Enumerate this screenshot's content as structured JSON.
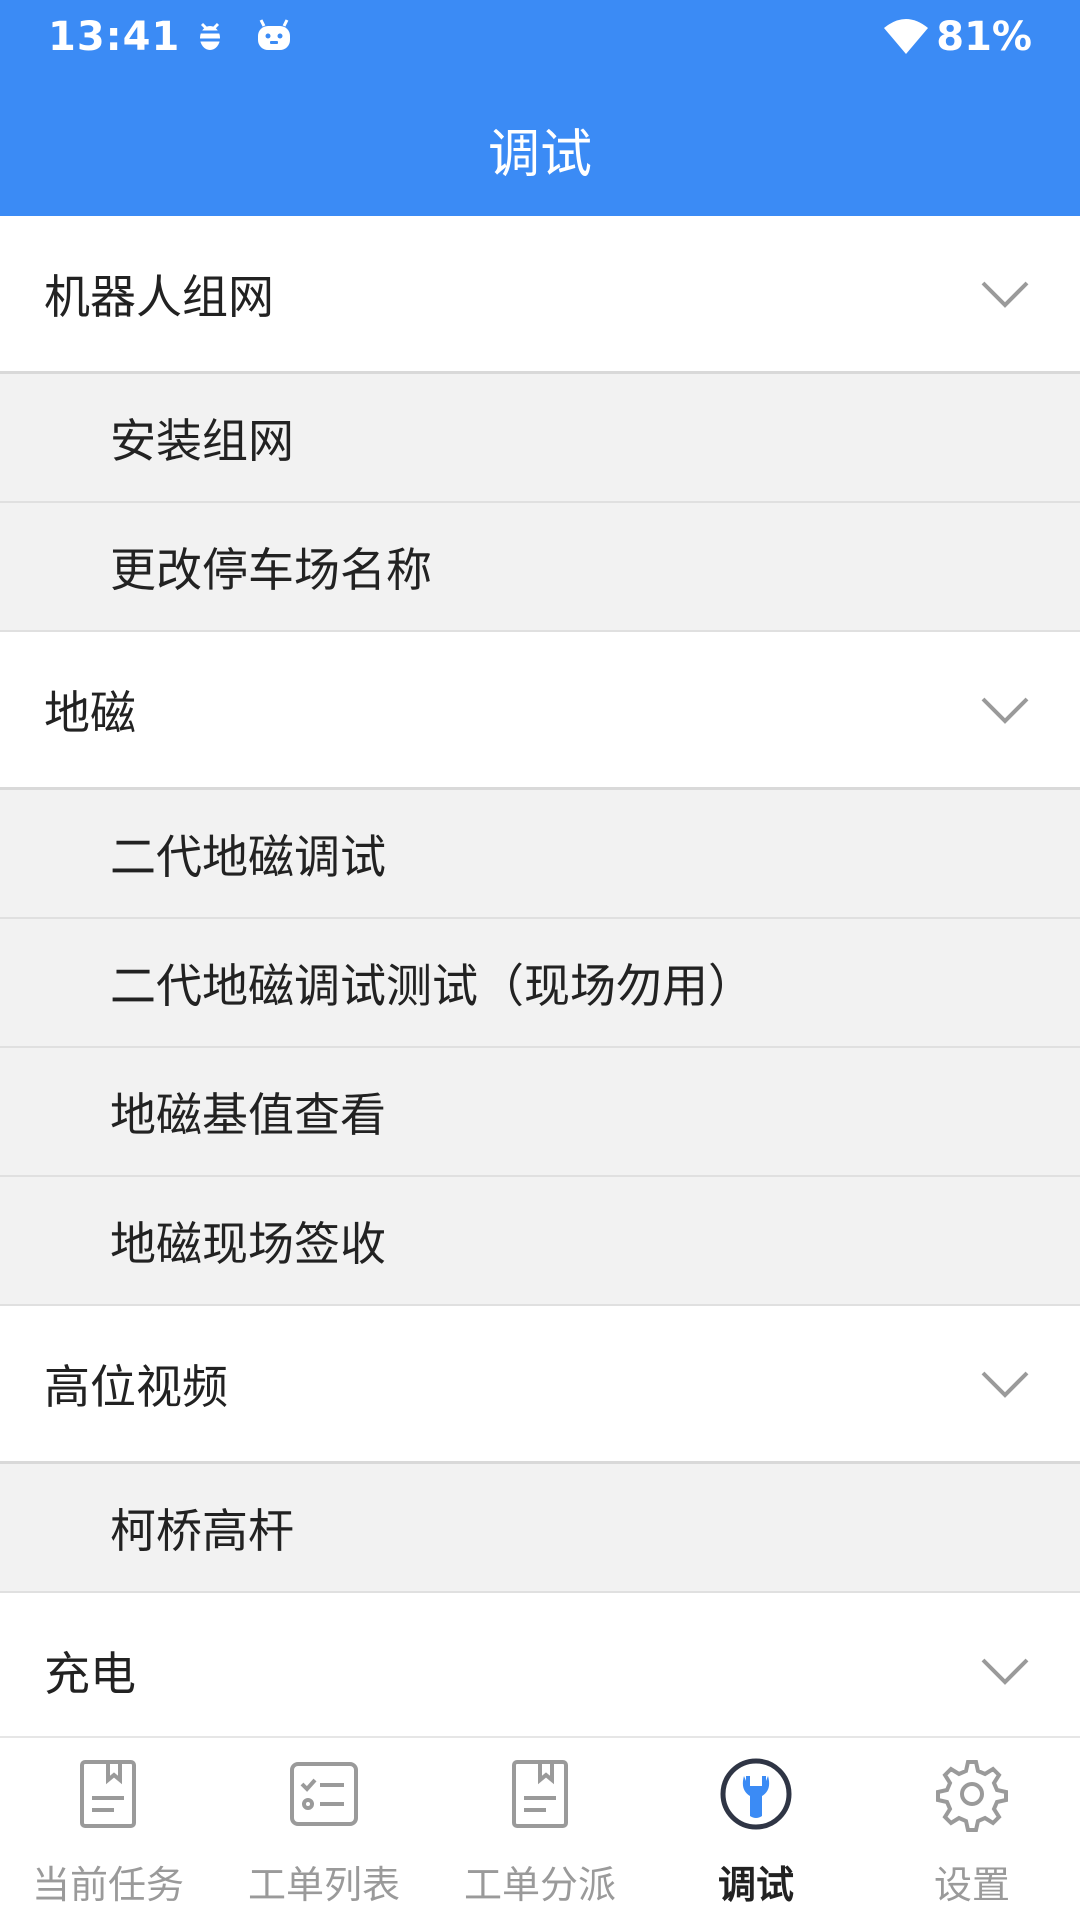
{
  "status_bar": {
    "time": "13:41",
    "battery": "81%"
  },
  "header": {
    "title": "调试"
  },
  "sections": [
    {
      "label": "机器人组网",
      "items": [
        "安装组网",
        "更改停车场名称"
      ]
    },
    {
      "label": "地磁",
      "items": [
        "二代地磁调试",
        "二代地磁调试测试（现场勿用）",
        "地磁基值查看",
        "地磁现场签收"
      ]
    },
    {
      "label": "高位视频",
      "items": [
        "柯桥高杆"
      ]
    },
    {
      "label": "充电",
      "items": []
    }
  ],
  "tabbar": {
    "tabs": [
      {
        "label": "当前任务",
        "icon": "document-icon"
      },
      {
        "label": "工单列表",
        "icon": "checklist-icon"
      },
      {
        "label": "工单分派",
        "icon": "document-icon"
      },
      {
        "label": "调试",
        "icon": "wrench-icon"
      },
      {
        "label": "设置",
        "icon": "gear-icon"
      }
    ],
    "active_index": 3
  },
  "colors": {
    "primary": "#3B8BF5",
    "inactive": "#9a9a9a"
  }
}
